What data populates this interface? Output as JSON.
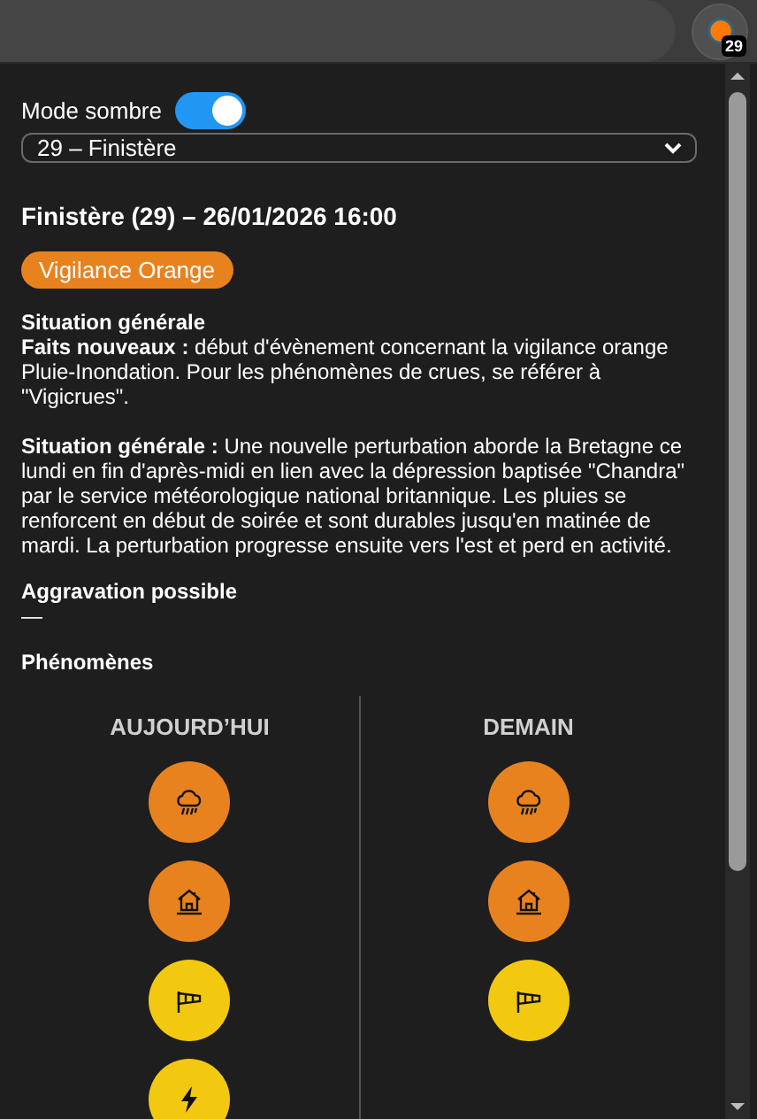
{
  "browser": {
    "extension_badge": "29"
  },
  "settings": {
    "dark_mode_label": "Mode sombre",
    "dark_mode_on": true,
    "department": "29 – Finistère"
  },
  "title": "Finistère (29) – 26/01/2026 16:00",
  "vigilance": {
    "label": "Vigilance Orange",
    "color": "#e8821f"
  },
  "sections": [
    {
      "heading": "Situation générale",
      "paragraphs": [
        "**Faits nouveaux :** début d'évènement concernant la vigilance orange Pluie-Inondation. Pour les phénomènes de crues, se référer à \"Vigicrues\".",
        "**Situation générale :** Une nouvelle perturbation aborde la Bretagne ce lundi en fin d'après-midi en lien avec la dépression baptisée \"Chandra\" par le service météorologique national britannique. Les pluies se renforcent en début de soirée et sont durables jusqu'en matinée de mardi. La perturbation progresse ensuite vers l'est et perd en activité."
      ]
    },
    {
      "heading": "Aggravation possible",
      "paragraphs": [
        "—"
      ]
    }
  ],
  "phenomena": {
    "heading": "Phénomènes",
    "days": [
      {
        "label": "AUJOURD’HUI",
        "items": [
          {
            "kind": "rain",
            "color": "#e8821f"
          },
          {
            "kind": "flood",
            "color": "#e8821f"
          },
          {
            "kind": "wind",
            "color": "#f2c811"
          },
          {
            "kind": "storm",
            "color": "#f2c811"
          }
        ]
      },
      {
        "label": "DEMAIN",
        "items": [
          {
            "kind": "rain",
            "color": "#e8821f"
          },
          {
            "kind": "flood",
            "color": "#e8821f"
          },
          {
            "kind": "wind",
            "color": "#f2c811"
          }
        ]
      }
    ]
  }
}
